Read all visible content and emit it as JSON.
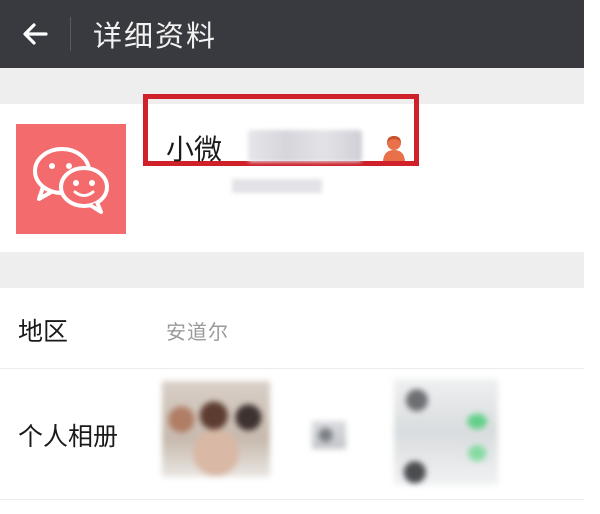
{
  "header": {
    "title": "详细资料",
    "back_icon": "arrow-left-icon",
    "background": "#393a3f"
  },
  "profile": {
    "avatar_icon": "wechat-logo-icon",
    "avatar_color": "#f36b6d",
    "nickname": "小微",
    "gender_icon": "female-user-icon",
    "gender_color": "#e8714a",
    "highlight_color": "#d0202a"
  },
  "details": {
    "region_label": "地区",
    "region_value": "安道尔",
    "album_label": "个人相册"
  }
}
